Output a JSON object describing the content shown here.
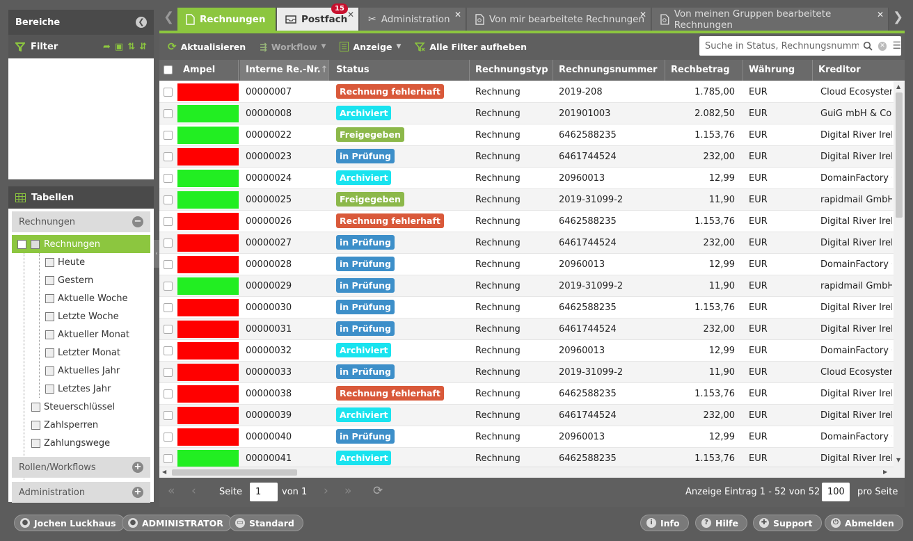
{
  "left": {
    "bereiche_title": "Bereiche",
    "filter_label": "Filter",
    "tabellen_title": "Tabellen",
    "rechnungen_group": "Rechnungen",
    "tree_selected": "Rechnungen",
    "tree_items": [
      "Heute",
      "Gestern",
      "Aktuelle Woche",
      "Letzte Woche",
      "Aktueller Monat",
      "Letzter Monat",
      "Aktuelles Jahr",
      "Letztes Jahr"
    ],
    "extra_items": [
      "Steuerschlüssel",
      "Zahlsperren",
      "Zahlungswege"
    ],
    "rollen": "Rollen/Workflows",
    "administration": "Administration"
  },
  "tabs": [
    {
      "label": "Rechnungen",
      "active": true,
      "icon": "document-icon"
    },
    {
      "label": "Postfach",
      "badge": "15",
      "icon": "inbox-icon"
    },
    {
      "label": "Administration",
      "icon": "tools-icon"
    },
    {
      "label": "Von mir bearbeitete Rechnungen",
      "icon": "document-search-icon"
    },
    {
      "label": "Von meinen Gruppen bearbeitete Rechnungen",
      "icon": "document-search-icon"
    }
  ],
  "toolbar": {
    "refresh": "Aktualisieren",
    "workflow": "Workflow",
    "anzeige": "Anzeige",
    "clear_filters": "Alle Filter aufheben",
    "search_placeholder": "Suche in Status, Rechnungsnummer"
  },
  "columns": [
    "Ampel",
    "Interne Re.-Nr.",
    "Status",
    "Rechnungstyp",
    "Rechnungsnummer",
    "Rechbetrag",
    "Währung",
    "Kreditor"
  ],
  "status_colors": {
    "Rechnung fehlerhaft": "#d9593a",
    "Archiviert": "#19e3ef",
    "Freigegeben": "#8cb84a",
    "in Prüfung": "#3d8fc9"
  },
  "ampel_colors": {
    "red": "#ff0000",
    "green": "#22ee22"
  },
  "rows": [
    {
      "ampel": "red",
      "nr": "00000007",
      "status": "Rechnung fehlerhaft",
      "typ": "Rechnung",
      "rnr": "2019-208",
      "betrag": "1.785,00",
      "waehrung": "EUR",
      "kreditor": "Cloud Ecosystem"
    },
    {
      "ampel": "green",
      "nr": "00000008",
      "status": "Archiviert",
      "typ": "Rechnung",
      "rnr": "201901003",
      "betrag": "2.082,50",
      "waehrung": "EUR",
      "kreditor": "GuiG mbH & Co.K"
    },
    {
      "ampel": "green",
      "nr": "00000022",
      "status": "Freigegeben",
      "typ": "Rechnung",
      "rnr": "6462588235",
      "betrag": "1.153,76",
      "waehrung": "EUR",
      "kreditor": "Digital River Irela"
    },
    {
      "ampel": "red",
      "nr": "00000023",
      "status": "in Prüfung",
      "typ": "Rechnung",
      "rnr": "6461744524",
      "betrag": "232,00",
      "waehrung": "EUR",
      "kreditor": "Digital River Irela"
    },
    {
      "ampel": "green",
      "nr": "00000024",
      "status": "Archiviert",
      "typ": "Rechnung",
      "rnr": "20960013",
      "betrag": "12,99",
      "waehrung": "EUR",
      "kreditor": "DomainFactory G"
    },
    {
      "ampel": "green",
      "nr": "00000025",
      "status": "Freigegeben",
      "typ": "Rechnung",
      "rnr": "2019-31099-2",
      "betrag": "11,90",
      "waehrung": "EUR",
      "kreditor": "rapidmail GmbH"
    },
    {
      "ampel": "red",
      "nr": "00000026",
      "status": "Rechnung fehlerhaft",
      "typ": "Rechnung",
      "rnr": "6462588235",
      "betrag": "1.153,76",
      "waehrung": "EUR",
      "kreditor": "Digital River Irela"
    },
    {
      "ampel": "red",
      "nr": "00000027",
      "status": "in Prüfung",
      "typ": "Rechnung",
      "rnr": "6461744524",
      "betrag": "232,00",
      "waehrung": "EUR",
      "kreditor": "Digital River Irela"
    },
    {
      "ampel": "red",
      "nr": "00000028",
      "status": "in Prüfung",
      "typ": "Rechnung",
      "rnr": "20960013",
      "betrag": "12,99",
      "waehrung": "EUR",
      "kreditor": "DomainFactory G"
    },
    {
      "ampel": "green",
      "nr": "00000029",
      "status": "in Prüfung",
      "typ": "Rechnung",
      "rnr": "2019-31099-2",
      "betrag": "11,90",
      "waehrung": "EUR",
      "kreditor": "rapidmail GmbH"
    },
    {
      "ampel": "red",
      "nr": "00000030",
      "status": "in Prüfung",
      "typ": "Rechnung",
      "rnr": "6462588235",
      "betrag": "1.153,76",
      "waehrung": "EUR",
      "kreditor": "Digital River Irela"
    },
    {
      "ampel": "red",
      "nr": "00000031",
      "status": "in Prüfung",
      "typ": "Rechnung",
      "rnr": "6461744524",
      "betrag": "232,00",
      "waehrung": "EUR",
      "kreditor": "Digital River Irela"
    },
    {
      "ampel": "red",
      "nr": "00000032",
      "status": "Archiviert",
      "typ": "Rechnung",
      "rnr": "20960013",
      "betrag": "12,99",
      "waehrung": "EUR",
      "kreditor": "DomainFactory G"
    },
    {
      "ampel": "red",
      "nr": "00000033",
      "status": "in Prüfung",
      "typ": "Rechnung",
      "rnr": "2019-31099-2",
      "betrag": "11,90",
      "waehrung": "EUR",
      "kreditor": "Cloud Ecosystem"
    },
    {
      "ampel": "red",
      "nr": "00000038",
      "status": "Rechnung fehlerhaft",
      "typ": "Rechnung",
      "rnr": "6462588235",
      "betrag": "1.153,76",
      "waehrung": "EUR",
      "kreditor": "Digital River Irela"
    },
    {
      "ampel": "red",
      "nr": "00000039",
      "status": "Archiviert",
      "typ": "Rechnung",
      "rnr": "6461744524",
      "betrag": "232,00",
      "waehrung": "EUR",
      "kreditor": "Digital River Irela"
    },
    {
      "ampel": "red",
      "nr": "00000040",
      "status": "in Prüfung",
      "typ": "Rechnung",
      "rnr": "20960013",
      "betrag": "12,99",
      "waehrung": "EUR",
      "kreditor": "DomainFactory G"
    },
    {
      "ampel": "green",
      "nr": "00000041",
      "status": "Archiviert",
      "typ": "Rechnung",
      "rnr": "6462588235",
      "betrag": "1.153,76",
      "waehrung": "EUR",
      "kreditor": "Digital River Irela"
    }
  ],
  "pager": {
    "seite": "Seite",
    "page_value": "1",
    "von": "von 1",
    "summary": "Anzeige Eintrag 1 - 52 von 52",
    "per_page": "100",
    "pro_seite": "pro Seite"
  },
  "footer": {
    "user": "Jochen Luckhaus",
    "role": "ADMINISTRATOR",
    "view": "Standard",
    "info": "Info",
    "hilfe": "Hilfe",
    "support": "Support",
    "abmelden": "Abmelden"
  }
}
